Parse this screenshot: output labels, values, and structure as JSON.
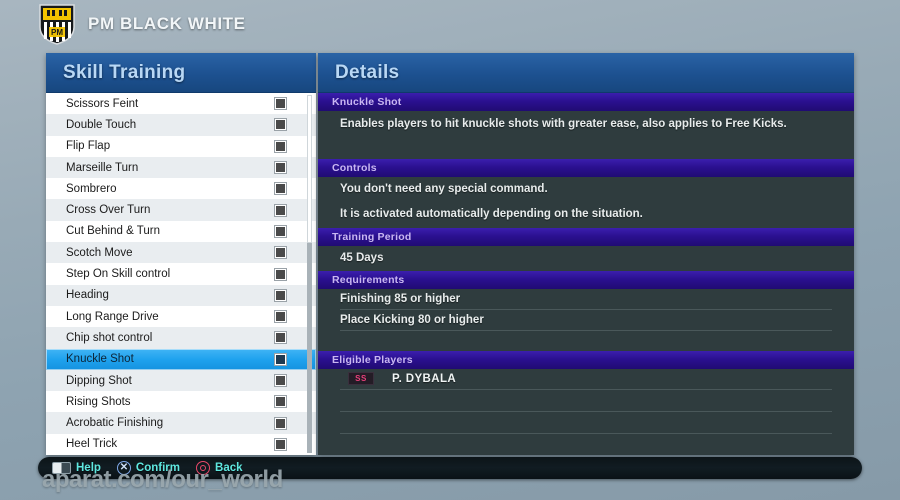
{
  "header": {
    "club_name": "PM BLACK WHITE",
    "crest_letters": "PM",
    "crest_motto": "PM BLACK WHITE"
  },
  "skill_panel": {
    "title": "Skill Training",
    "items": [
      {
        "label": "Scissors Feint"
      },
      {
        "label": "Double Touch"
      },
      {
        "label": "Flip Flap"
      },
      {
        "label": "Marseille Turn"
      },
      {
        "label": "Sombrero"
      },
      {
        "label": "Cross Over Turn"
      },
      {
        "label": "Cut Behind & Turn"
      },
      {
        "label": "Scotch Move"
      },
      {
        "label": "Step On Skill control"
      },
      {
        "label": "Heading"
      },
      {
        "label": "Long Range Drive"
      },
      {
        "label": "Chip shot control"
      },
      {
        "label": "Knuckle Shot"
      },
      {
        "label": "Dipping Shot"
      },
      {
        "label": "Rising Shots"
      },
      {
        "label": "Acrobatic Finishing"
      },
      {
        "label": "Heel Trick"
      }
    ],
    "selected_index": 12
  },
  "details_panel": {
    "title": "Details",
    "skill_name_header": "Knuckle Shot",
    "description": "Enables players to hit knuckle shots with greater ease, also applies to Free Kicks.",
    "controls_header": "Controls",
    "controls_lines": [
      "You don't need any special command.",
      "It is activated automatically depending on the situation."
    ],
    "training_period_header": "Training Period",
    "training_period_value": "45 Days",
    "requirements_header": "Requirements",
    "requirements": [
      "Finishing 85 or higher",
      "Place Kicking 80 or higher"
    ],
    "eligible_players_header": "Eligible Players",
    "eligible_players": [
      {
        "position": "SS",
        "name": "P. DYBALA"
      }
    ]
  },
  "button_bar": {
    "buttons": [
      {
        "icon": "touchpad-icon",
        "label": "Help"
      },
      {
        "icon": "cross-button-icon",
        "label": "Confirm"
      },
      {
        "icon": "circle-button-icon",
        "label": "Back"
      }
    ]
  },
  "watermark": {
    "text": "aparat.com/our_world"
  },
  "colors": {
    "background": "#8ea3b1",
    "panel_header_blue": "#1d5190",
    "header_text_blue": "#b9d8f5",
    "selection_blue": "#1fa2ee",
    "section_purple": "#2b1090",
    "section_text_purple": "#c9b7f2",
    "details_body": "#2f3c3e",
    "button_bar_text": "#5fe8e0",
    "position_badge_pink": "#e8407a",
    "crest_yellow": "#f2c300"
  }
}
